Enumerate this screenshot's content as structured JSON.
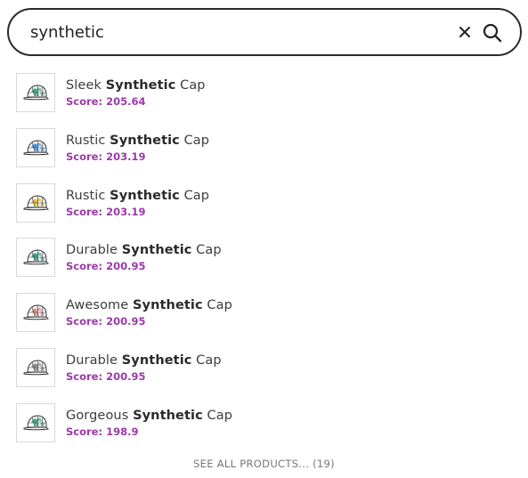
{
  "search": {
    "value": "synthetic",
    "clear_icon": "close-icon",
    "search_icon": "search-icon"
  },
  "results": [
    {
      "prefix": "Sleek ",
      "match": "Synthetic",
      "suffix": " Cap",
      "score_label": "Score: 205.64",
      "accent": "#1f9e6e"
    },
    {
      "prefix": "Rustic ",
      "match": "Synthetic",
      "suffix": " Cap",
      "score_label": "Score: 203.19",
      "accent": "#2f7fd8"
    },
    {
      "prefix": "Rustic ",
      "match": "Synthetic",
      "suffix": " Cap",
      "score_label": "Score: 203.19",
      "accent": "#e8b21c"
    },
    {
      "prefix": "Durable ",
      "match": "Synthetic",
      "suffix": " Cap",
      "score_label": "Score: 200.95",
      "accent": "#1b8f7a"
    },
    {
      "prefix": "Awesome ",
      "match": "Synthetic",
      "suffix": " Cap",
      "score_label": "Score: 200.95",
      "accent": "#e07a7a"
    },
    {
      "prefix": "Durable ",
      "match": "Synthetic",
      "suffix": " Cap",
      "score_label": "Score: 200.95",
      "accent": "#7d7d7d"
    },
    {
      "prefix": "Gorgeous ",
      "match": "Synthetic",
      "suffix": " Cap",
      "score_label": "Score: 198.9",
      "accent": "#1f9e6e"
    }
  ],
  "see_all_label": "SEE ALL PRODUCTS... (19)",
  "colors": {
    "score": "#9b3aa8",
    "border": "#2b2b2b"
  }
}
